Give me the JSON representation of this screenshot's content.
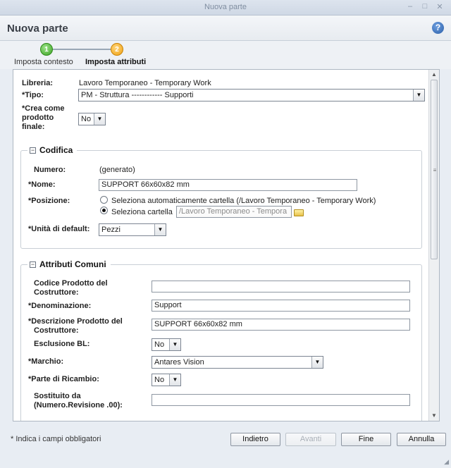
{
  "window": {
    "title": "Nuova parte",
    "controls": [
      "–",
      "□",
      "✕"
    ]
  },
  "header": {
    "title": "Nuova parte",
    "help_label": "?"
  },
  "steps": [
    {
      "number": "1",
      "label": "Imposta contesto",
      "state": "done",
      "color": "#3aa023"
    },
    {
      "number": "2",
      "label": "Imposta attributi",
      "state": "active",
      "color": "#f0a214"
    }
  ],
  "form": {
    "libreria": {
      "label": "Libreria:",
      "value": "Lavoro Temporaneo - Temporary Work"
    },
    "tipo": {
      "label": "Tipo:",
      "value": "PM - Struttura ------------ Supporti"
    },
    "crea": {
      "label_lines": [
        "Crea come",
        "prodotto",
        "finale:"
      ],
      "value": "No"
    },
    "required_mark": "*"
  },
  "codifica": {
    "legend": "Codifica",
    "numero": {
      "label": "Numero:",
      "value": "(generato)"
    },
    "nome": {
      "label": "Nome:",
      "value": "SUPPORT 66x60x82 mm"
    },
    "posizione": {
      "label": "Posizione:",
      "auto_label": "Seleziona automaticamente cartella (/Lavoro Temporaneo - Temporary Work)",
      "select_label": "Seleziona cartella",
      "folder_value": "/Lavoro Temporaneo - Tempora",
      "selected": "select"
    },
    "unita": {
      "label": "Unità di default:",
      "value": "Pezzi"
    }
  },
  "attributi": {
    "legend": "Attributi Comuni",
    "codice": {
      "label_lines": [
        "Codice Prodotto del",
        "Costruttore:"
      ],
      "value": ""
    },
    "denominazione": {
      "label": "Denominazione:",
      "value": "Support"
    },
    "descrizione": {
      "label_lines": [
        "Descrizione Prodotto del",
        "Costruttore:"
      ],
      "value": "SUPPORT 66x60x82 mm"
    },
    "esclusione": {
      "label": "Esclusione BL:",
      "value": "No"
    },
    "marchio": {
      "label": "Marchio:",
      "value": "Antares Vision"
    },
    "ricambio": {
      "label": "Parte di Ricambio:",
      "value": "No"
    },
    "sostituito": {
      "label_lines": [
        "Sostituito da",
        "(Numero.Revisione .00):"
      ],
      "value": ""
    }
  },
  "footer": {
    "note": "* Indica i campi obbligatori",
    "buttons": [
      {
        "label": "Indietro",
        "enabled": true
      },
      {
        "label": "Avanti",
        "enabled": false
      },
      {
        "label": "Fine",
        "enabled": true
      },
      {
        "label": "Annulla",
        "enabled": true
      }
    ]
  }
}
